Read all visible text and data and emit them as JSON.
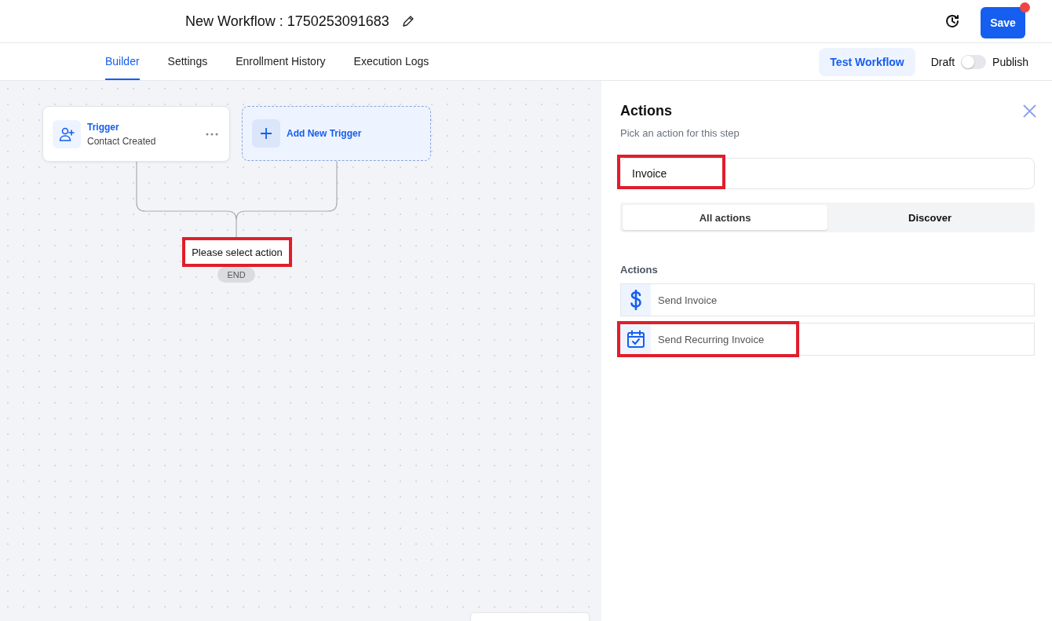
{
  "header": {
    "title": "New Workflow : 1750253091683",
    "save_button": "Save",
    "save_notification": true
  },
  "tabs": [
    {
      "label": "Builder",
      "selected": true
    },
    {
      "label": "Settings",
      "selected": false
    },
    {
      "label": "Enrollment History",
      "selected": false
    },
    {
      "label": "Execution Logs",
      "selected": false
    }
  ],
  "test_button": "Test Workflow",
  "publish_toggle": {
    "off_label": "Draft",
    "on_label": "Publish",
    "on": false
  },
  "canvas": {
    "trigger": {
      "title": "Trigger",
      "subtitle": "Contact Created"
    },
    "add_trigger": "Add New Trigger",
    "placeholder": {
      "label": "Please select action",
      "highlighted": true
    },
    "end_label": "END"
  },
  "panel": {
    "title": "Actions",
    "subtitle": "Pick an action for this step",
    "search": {
      "value": "Invoice",
      "highlighted": true
    },
    "segments": [
      {
        "label": "All actions",
        "selected": true
      },
      {
        "label": "Discover",
        "selected": false
      }
    ],
    "section_title": "Actions",
    "actions": [
      {
        "label": "Send Invoice",
        "kind": "dollar",
        "highlighted": false
      },
      {
        "label": "Send Recurring Invoice",
        "kind": "calendar",
        "highlighted": true
      }
    ]
  }
}
